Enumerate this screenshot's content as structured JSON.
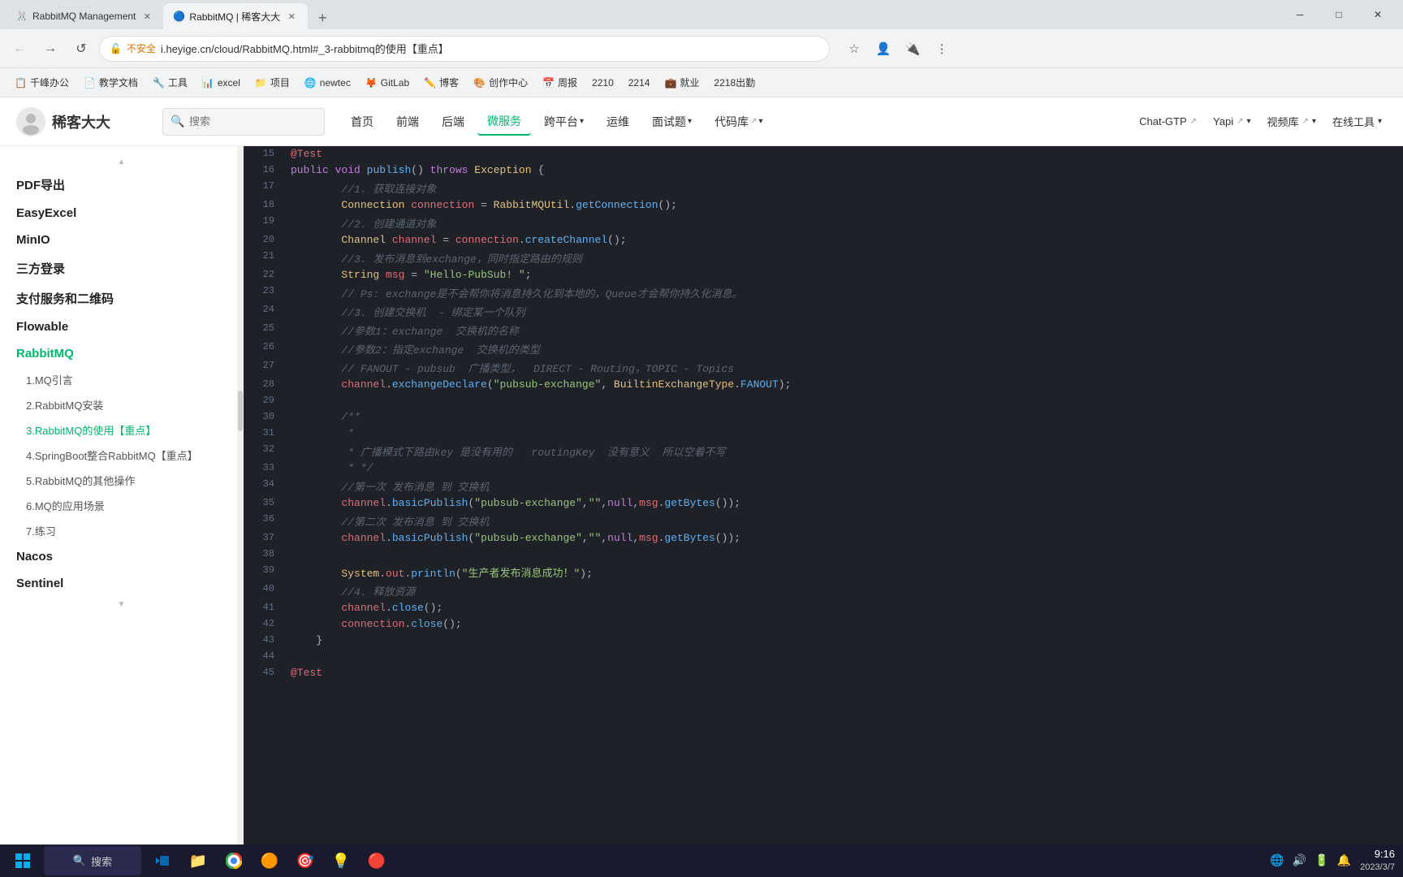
{
  "titlebar": {
    "tabs": [
      {
        "id": "tab1",
        "label": "RabbitMQ Management",
        "favicon": "🐰",
        "active": false
      },
      {
        "id": "tab2",
        "label": "RabbitMQ | 稀客大大",
        "favicon": "🔵",
        "active": true
      }
    ],
    "new_tab_label": "+",
    "window_controls": {
      "minimize": "─",
      "maximize": "□",
      "close": "✕"
    }
  },
  "addressbar": {
    "back_btn": "←",
    "forward_btn": "→",
    "refresh_btn": "↺",
    "home_btn": "⌂",
    "lock_label": "不安全",
    "url": "i.heyige.cn/cloud/RabbitMQ.html#_3-rabbitmq的使用【重点】",
    "full_url": "https://i.heyige.cn/cloud/RabbitMQ.html#_3-rabbitmq的使用【重点】"
  },
  "bookmarks": [
    {
      "label": "千峰办公",
      "favicon": "📋"
    },
    {
      "label": "教学文档",
      "favicon": "📄"
    },
    {
      "label": "工具",
      "favicon": "🔧"
    },
    {
      "label": "excel",
      "favicon": "📊"
    },
    {
      "label": "项目",
      "favicon": "📁"
    },
    {
      "label": "newtec",
      "favicon": "🌐"
    },
    {
      "label": "GitLab",
      "favicon": "🦊"
    },
    {
      "label": "博客",
      "favicon": "✏️"
    },
    {
      "label": "创作中心",
      "favicon": "🎨"
    },
    {
      "label": "周报",
      "favicon": "📅"
    },
    {
      "label": "2210",
      "favicon": "📌"
    },
    {
      "label": "2214",
      "favicon": "📌"
    },
    {
      "label": "就业",
      "favicon": "💼"
    },
    {
      "label": "2218出勤",
      "favicon": "📌"
    }
  ],
  "site": {
    "logo": "稀客大大",
    "search_placeholder": "搜索",
    "nav_links": [
      {
        "label": "首页",
        "active": false
      },
      {
        "label": "前端",
        "active": false
      },
      {
        "label": "后端",
        "active": false
      },
      {
        "label": "微服务",
        "active": true
      },
      {
        "label": "跨平台",
        "active": false,
        "arrow": true
      },
      {
        "label": "运维",
        "active": false
      },
      {
        "label": "面试题",
        "active": false,
        "arrow": true
      },
      {
        "label": "代码库",
        "active": false,
        "external": true,
        "arrow": true
      }
    ],
    "nav_right": [
      {
        "label": "Chat-GTP",
        "external": true
      },
      {
        "label": "Yapi",
        "external": true,
        "arrow": true
      },
      {
        "label": "视频库",
        "external": true,
        "arrow": true
      },
      {
        "label": "在线工具",
        "arrow": true
      }
    ]
  },
  "sidebar": {
    "items": [
      {
        "label": "PDF导出",
        "type": "section",
        "active": false
      },
      {
        "label": "EasyExcel",
        "type": "section",
        "active": false
      },
      {
        "label": "MinIO",
        "type": "section",
        "active": false
      },
      {
        "label": "三方登录",
        "type": "section",
        "active": false
      },
      {
        "label": "支付服务和二维码",
        "type": "section",
        "active": false
      },
      {
        "label": "Flowable",
        "type": "section",
        "active": false
      },
      {
        "label": "RabbitMQ",
        "type": "section",
        "active": true
      },
      {
        "label": "1.MQ引言",
        "type": "sub",
        "active": false
      },
      {
        "label": "2.RabbitMQ安装",
        "type": "sub",
        "active": false
      },
      {
        "label": "3.RabbitMQ的使用【重点】",
        "type": "sub",
        "active": true
      },
      {
        "label": "4.SpringBoot整合RabbitMQ【重点】",
        "type": "sub",
        "active": false
      },
      {
        "label": "5.RabbitMQ的其他操作",
        "type": "sub",
        "active": false
      },
      {
        "label": "6.MQ的应用场景",
        "type": "sub",
        "active": false
      },
      {
        "label": "7.练习",
        "type": "sub",
        "active": false
      },
      {
        "label": "Nacos",
        "type": "section",
        "active": false
      },
      {
        "label": "Sentinel",
        "type": "section",
        "active": false
      }
    ]
  },
  "code": {
    "lines": [
      {
        "num": 15,
        "html": "<span class='ann'>@Test</span>"
      },
      {
        "num": 16,
        "html": "<span class='kw'>public</span> <span class='kw'>void</span> <span class='fn'>publish</span>() <span class='kw'>throws</span> <span class='cls'>Exception</span> {"
      },
      {
        "num": 17,
        "html": "        <span class='cmt'>//1. 获取连接对象</span>"
      },
      {
        "num": 18,
        "html": "        <span class='cls'>Connection</span> <span class='var'>connection</span> = <span class='cls'>RabbitMQUtil</span>.<span class='method'>getConnection</span>();"
      },
      {
        "num": 19,
        "html": "        <span class='cmt'>//2. 创建通道对象</span>"
      },
      {
        "num": 20,
        "html": "        <span class='cls'>Channel</span> <span class='var'>channel</span> = <span class='var'>connection</span>.<span class='method'>createChannel</span>();"
      },
      {
        "num": 21,
        "html": "        <span class='cmt'>//3. 发布消息到exchange，同时指定路由的规则</span>"
      },
      {
        "num": 22,
        "html": "        <span class='cls'>String</span> <span class='var'>msg</span> = <span class='str'>\"Hello-PubSub! \"</span>;"
      },
      {
        "num": 23,
        "html": "        <span class='cmt'>// Ps: exchange是不会帮你将消息持久化到本地的，Queue才会帮你持久化消息。</span>"
      },
      {
        "num": 24,
        "html": "        <span class='cmt'>//3. 创建交换机  - 绑定某一个队列</span>"
      },
      {
        "num": 25,
        "html": "        <span class='cmt'>//参数1：exchange  交换机的名称</span>"
      },
      {
        "num": 26,
        "html": "        <span class='cmt'>//参数2：指定exchange  交换机的类型</span>"
      },
      {
        "num": 27,
        "html": "        <span class='cmt'>// FANOUT - pubsub  广播类型，  DIRECT - Routing，TOPIC - Topics</span>"
      },
      {
        "num": 28,
        "html": "        <span class='var'>channel</span>.<span class='method'>exchangeDeclare</span>(<span class='str'>\"pubsub-exchange\"</span>, <span class='cls'>BuiltinExchangeType</span>.<span class='fn'>FANOUT</span>);"
      },
      {
        "num": 29,
        "html": ""
      },
      {
        "num": 30,
        "html": "        <span class='cmt'>/**</span>"
      },
      {
        "num": 31,
        "html": "         <span class='cmt'>*</span>"
      },
      {
        "num": 32,
        "html": "         <span class='cmt'>* 广播模式下路由key 是没有用的   routingKey  没有意义  所以空着不写</span>"
      },
      {
        "num": 33,
        "html": "         <span class='cmt'>* */</span>"
      },
      {
        "num": 34,
        "html": "        <span class='cmt'>//第一次 发布消息 到 交换机</span>"
      },
      {
        "num": 35,
        "html": "        <span class='var'>channel</span>.<span class='method'>basicPublish</span>(<span class='str'>\"pubsub-exchange\"</span>,<span class='str'>\"\"</span>,<span class='kw'>null</span>,<span class='var'>msg</span>.<span class='method'>getBytes</span>());"
      },
      {
        "num": 36,
        "html": "        <span class='cmt'>//第二次 发布消息 到 交换机</span>"
      },
      {
        "num": 37,
        "html": "        <span class='var'>channel</span>.<span class='method'>basicPublish</span>(<span class='str'>\"pubsub-exchange\"</span>,<span class='str'>\"\"</span>,<span class='kw'>null</span>,<span class='var'>msg</span>.<span class='method'>getBytes</span>());"
      },
      {
        "num": 38,
        "html": ""
      },
      {
        "num": 39,
        "html": "        <span class='cls'>System</span>.<span class='var'>out</span>.<span class='method'>println</span>(<span class='str'>\"生产者发布消息成功！\"</span>);"
      },
      {
        "num": 40,
        "html": "        <span class='cmt'>//4. 释放资源</span>"
      },
      {
        "num": 41,
        "html": "        <span class='var'>channel</span>.<span class='method'>close</span>();"
      },
      {
        "num": 42,
        "html": "        <span class='var'>connection</span>.<span class='method'>close</span>();"
      },
      {
        "num": 43,
        "html": "    }"
      },
      {
        "num": 44,
        "html": ""
      },
      {
        "num": 45,
        "html": "<span class='ann'>@Test</span>"
      }
    ]
  },
  "taskbar": {
    "start_icon": "⊞",
    "search_label": "搜索",
    "time": "9:16",
    "date": "2023/3/7",
    "icons": [
      "🔵",
      "📁",
      "🌐",
      "🟠",
      "🎯",
      "💡",
      "🔴"
    ]
  }
}
